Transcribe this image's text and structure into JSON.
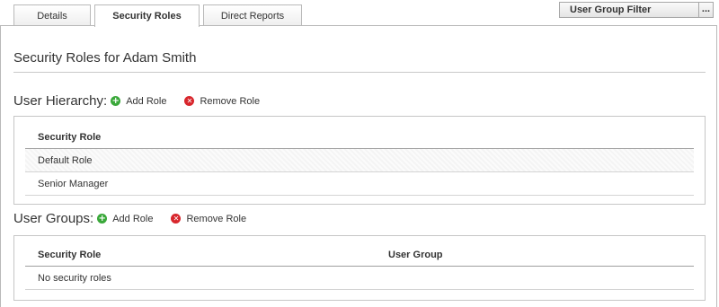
{
  "tabs": [
    {
      "label": "Details"
    },
    {
      "label": "Security Roles"
    },
    {
      "label": "Direct Reports"
    }
  ],
  "filter": {
    "label": "User Group Filter",
    "button": "..."
  },
  "page_title": "Security Roles for Adam Smith",
  "user_hierarchy": {
    "title": "User Hierarchy:",
    "add_label": "Add Role",
    "remove_label": "Remove Role",
    "column": "Security Role",
    "rows": [
      "Default Role",
      "Senior Manager"
    ]
  },
  "user_groups": {
    "title": "User Groups:",
    "add_label": "Add Role",
    "remove_label": "Remove Role",
    "columns": [
      "Security Role",
      "User Group"
    ],
    "empty_text": "No security roles"
  },
  "icons": {
    "add": "plus-circle-icon",
    "remove": "x-circle-icon"
  },
  "colors": {
    "add": "#3aa83a",
    "remove": "#d8262c",
    "border": "#b9b9b9"
  }
}
